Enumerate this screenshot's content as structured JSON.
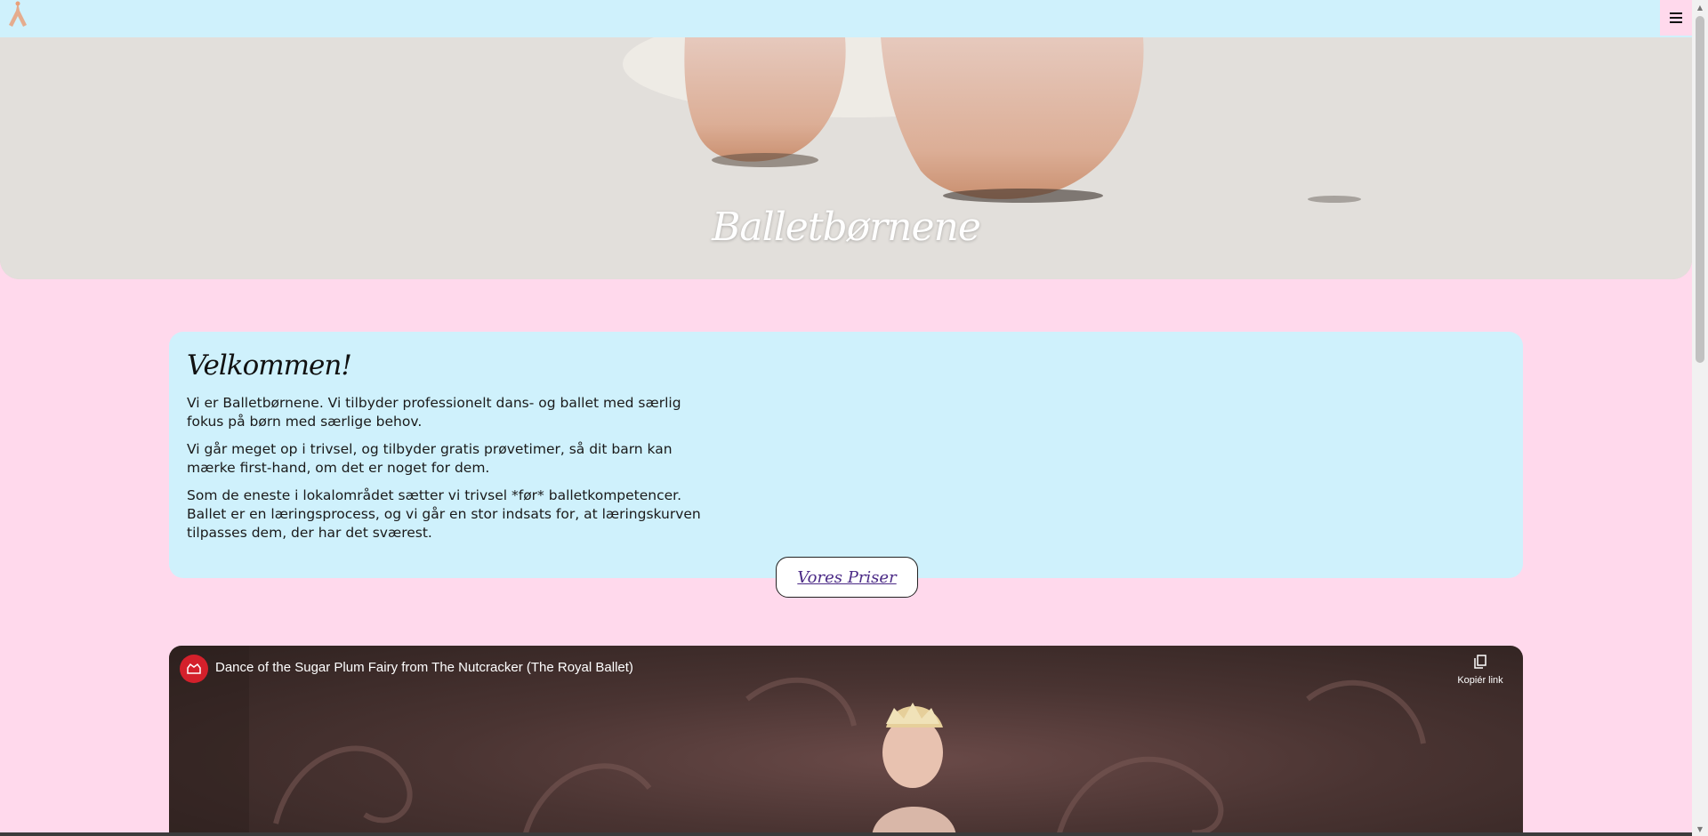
{
  "nav": {
    "menu_icon": "hamburger-icon",
    "logo_icon": "ballerina-logo-icon"
  },
  "hero": {
    "title": "Balletbørnene"
  },
  "welcome": {
    "title": "Velkommen!",
    "paragraphs": [
      "Vi er Balletbørnene. Vi tilbyder professionelt dans- og ballet med særlig fokus på børn med særlige behov.",
      "Vi går meget op i trivsel, og tilbyder gratis prøvetimer, så dit barn kan mærke first-hand, om det er noget for dem.",
      "Som de eneste i lokalområdet sætter vi trivsel *før* balletkompetencer. Ballet er en læringsprocess, og vi går en stor indsats for, at læringskurven tilpasses dem, der har det sværest."
    ]
  },
  "prices_button": {
    "label": "Vores Priser"
  },
  "video": {
    "title": "Dance of the Sugar Plum Fairy from The Nutcracker (The Royal Ballet)",
    "copy_link_label": "Kopiér link",
    "copy_icon": "copy-icon"
  },
  "colors": {
    "nav_bg": "#cff1fc",
    "page_bg": "#ffd9ec",
    "card_bg": "#cff1fc",
    "link": "#4b2a86"
  }
}
